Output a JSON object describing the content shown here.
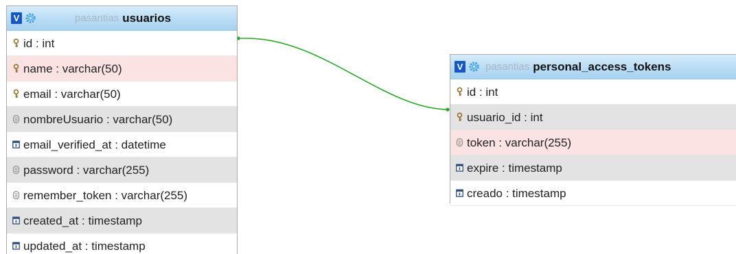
{
  "tables": {
    "usuarios": {
      "toggle_label": "V",
      "db_name": "pasantias",
      "table_name": "usuarios",
      "columns": [
        {
          "text": "id : int",
          "icon": "key-icon",
          "shade": "white"
        },
        {
          "text": "name : varchar(50)",
          "icon": "key-icon",
          "shade": "pink"
        },
        {
          "text": "email : varchar(50)",
          "icon": "key-icon",
          "shade": "white"
        },
        {
          "text": "nombreUsuario : varchar(50)",
          "icon": "text-column-icon",
          "shade": "gray"
        },
        {
          "text": "email_verified_at : datetime",
          "icon": "datetime-column-icon",
          "shade": "white"
        },
        {
          "text": "password : varchar(255)",
          "icon": "text-column-icon",
          "shade": "gray"
        },
        {
          "text": "remember_token : varchar(255)",
          "icon": "text-column-icon",
          "shade": "white"
        },
        {
          "text": "created_at : timestamp",
          "icon": "datetime-column-icon",
          "shade": "gray"
        },
        {
          "text": "updated_at : timestamp",
          "icon": "datetime-column-icon",
          "shade": "white"
        }
      ]
    },
    "personal_access_tokens": {
      "toggle_label": "V",
      "db_name": "pasantias",
      "table_name": "personal_access_tokens",
      "columns": [
        {
          "text": "id : int",
          "icon": "key-icon",
          "shade": "white"
        },
        {
          "text": "usuario_id : int",
          "icon": "key-icon",
          "shade": "gray"
        },
        {
          "text": "token : varchar(255)",
          "icon": "text-column-icon",
          "shade": "pink"
        },
        {
          "text": "expire : timestamp",
          "icon": "datetime-column-icon",
          "shade": "gray"
        },
        {
          "text": "creado : timestamp",
          "icon": "datetime-column-icon",
          "shade": "white"
        }
      ]
    }
  },
  "relation": {
    "from": "usuarios.id",
    "to": "personal_access_tokens.usuario_id",
    "color": "#2aa52a"
  },
  "colors": {
    "header_bg": "#b9dcf4",
    "toggle_bg": "#1557c7",
    "row_gray": "#e3e3e3",
    "row_pink": "#fbe3e3"
  }
}
